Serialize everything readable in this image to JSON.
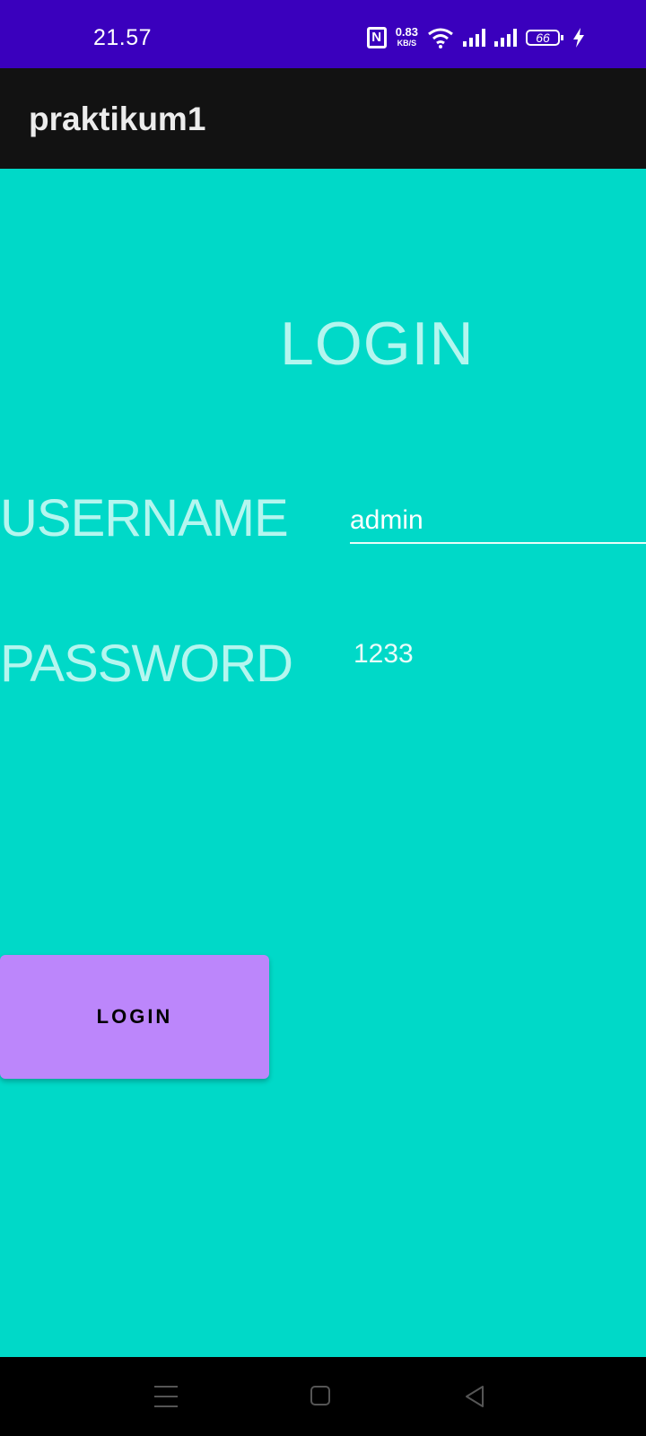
{
  "status_bar": {
    "time": "21.57",
    "nfc_label": "N",
    "net_speed_value": "0.83",
    "net_speed_unit": "KB/S",
    "battery_level": "66",
    "colors": {
      "background": "#3a00bd",
      "foreground": "#ffffff"
    },
    "icons": [
      "nfc-icon",
      "wifi-icon",
      "signal-icon",
      "signal-icon",
      "battery-icon",
      "charging-bolt-icon"
    ]
  },
  "app_bar": {
    "title": "praktikum1",
    "background": "#121212"
  },
  "form": {
    "heading": "LOGIN",
    "username_label": "USERNAME",
    "username_value": "admin",
    "password_label": "PASSWORD",
    "password_value": "1233",
    "submit_label": "LOGIN",
    "colors": {
      "background": "#00d9c8",
      "label": "#b4f6ef",
      "button": "#bc86fb"
    }
  },
  "nav_bar": {
    "icons": [
      "menu-icon",
      "home-icon",
      "back-icon"
    ]
  }
}
